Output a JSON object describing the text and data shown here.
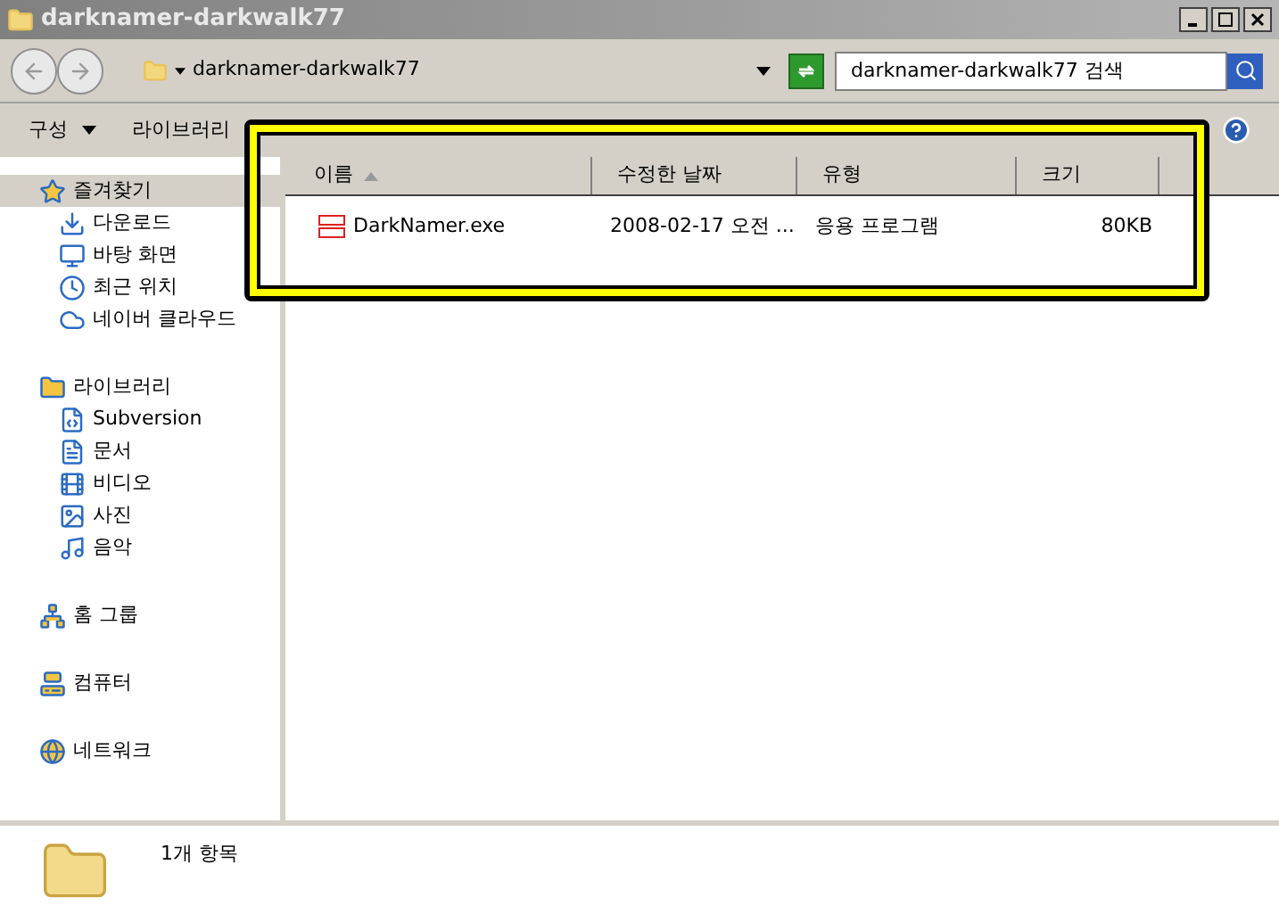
{
  "window": {
    "title": "darknamer-darkwalk77"
  },
  "address": {
    "path": "darknamer-darkwalk77"
  },
  "search": {
    "placeholder": "darknamer-darkwalk77 검색"
  },
  "toolbar": {
    "items": [
      {
        "label": "구성",
        "dropdown": true
      },
      {
        "label": "라이브러리",
        "dropdown": false
      }
    ]
  },
  "sidebar": {
    "groups": [
      {
        "label": "즐겨찾기",
        "selected": true,
        "children": [
          {
            "label": "다운로드"
          },
          {
            "label": "바탕 화면"
          },
          {
            "label": "최근 위치"
          },
          {
            "label": "네이버 클라우드"
          }
        ]
      },
      {
        "label": "라이브러리",
        "selected": false,
        "children": [
          {
            "label": "Subversion"
          },
          {
            "label": "문서"
          },
          {
            "label": "비디오"
          },
          {
            "label": "사진"
          },
          {
            "label": "음악"
          }
        ]
      },
      {
        "label": "홈 그룹",
        "selected": false
      },
      {
        "label": "컴퓨터",
        "selected": false
      },
      {
        "label": "네트워크",
        "selected": false
      }
    ]
  },
  "table": {
    "columns": [
      {
        "label": "이름",
        "sorted": true
      },
      {
        "label": "수정한 날짜",
        "sorted": false
      },
      {
        "label": "유형",
        "sorted": false
      },
      {
        "label": "크기",
        "sorted": false
      }
    ],
    "rows": [
      {
        "cells": [
          "DarkNamer.exe",
          "2008-02-17 오전 ...",
          "응용 프로그램",
          "80KB"
        ]
      }
    ]
  },
  "status_bar": {
    "text": "1개 항목"
  }
}
